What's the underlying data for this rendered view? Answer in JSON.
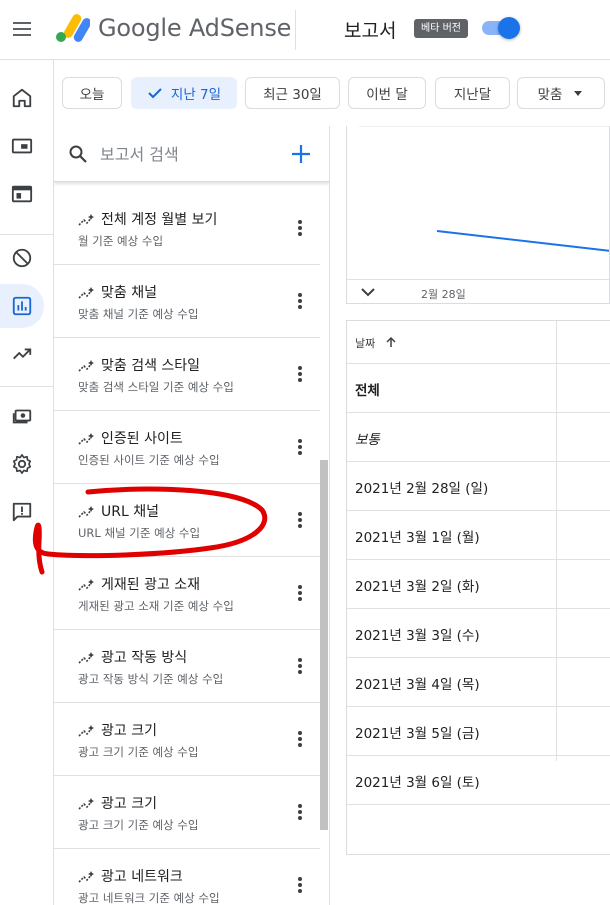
{
  "header": {
    "app_name_google": "Google",
    "app_name_product": "AdSense",
    "page_title": "보고서",
    "beta_badge": "베타 버전",
    "beta_toggle_on": true
  },
  "nav": {
    "items": [
      {
        "name": "home-icon"
      },
      {
        "name": "ads-icon"
      },
      {
        "name": "sites-icon"
      },
      {
        "name": "blocking-icon"
      },
      {
        "name": "reports-icon",
        "active": true
      },
      {
        "name": "optimization-icon"
      },
      {
        "name": "payments-icon"
      },
      {
        "name": "settings-icon"
      },
      {
        "name": "feedback-icon"
      }
    ]
  },
  "date_chips": [
    {
      "label": "오늘"
    },
    {
      "label": "지난 7일",
      "selected": true
    },
    {
      "label": "최근 30일"
    },
    {
      "label": "이번 달"
    },
    {
      "label": "지난달"
    },
    {
      "label": "맞춤"
    }
  ],
  "search": {
    "placeholder": "보고서 검색"
  },
  "reports": [
    {
      "title": "전체 계정 월별 보기",
      "subtitle": "월 기준 예상 수입"
    },
    {
      "title": "맞춤 채널",
      "subtitle": "맞춤 채널 기준 예상 수입"
    },
    {
      "title": "맞춤 검색 스타일",
      "subtitle": "맞춤 검색 스타일 기준 예상 수입"
    },
    {
      "title": "인증된 사이트",
      "subtitle": "인증된 사이트 기준 예상 수입"
    },
    {
      "title": "URL 채널",
      "subtitle": "URL 채널 기준 예상 수입"
    },
    {
      "title": "게재된 광고 소재",
      "subtitle": "게재된 광고 소재 기준 예상 수입"
    },
    {
      "title": "광고 작동 방식",
      "subtitle": "광고 작동 방식 기준 예상 수입"
    },
    {
      "title": "광고 크기",
      "subtitle": "광고 크기 기준 예상 수입"
    },
    {
      "title": "광고 크기",
      "subtitle": "광고 크기 기준 예상 수입"
    },
    {
      "title": "광고 네트워크",
      "subtitle": "광고 네트워크 기준 예상 수입"
    }
  ],
  "chart": {
    "date_label": "2월 28일"
  },
  "table": {
    "header": "날짜",
    "rows": [
      "전체",
      "보통",
      "2021년 2월 28일 (일)",
      "2021년 3월 1일 (월)",
      "2021년 3월 2일 (화)",
      "2021년 3월 3일 (수)",
      "2021년 3월 4일 (목)",
      "2021년 3월 5일 (금)",
      "2021년 3월 6일 (토)"
    ]
  },
  "colors": {
    "accent": "#1a73e8",
    "annotation": "#e00000"
  }
}
